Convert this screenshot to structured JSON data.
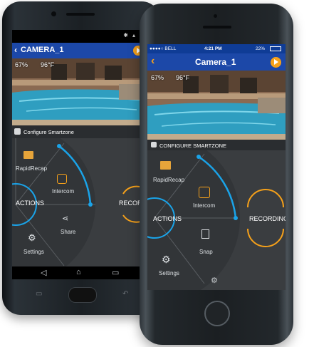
{
  "android": {
    "title": "CAMERA_1",
    "back_glyph": "‹",
    "humidity": "67%",
    "temperature": "96°F",
    "configure_label": "Configure Smartzone",
    "menu": {
      "rapidrecap": "RapidRecap",
      "intercom": "Intercom",
      "actions": "ACTIONS",
      "share": "Share",
      "settings": "Settings",
      "recording": "RECOR"
    },
    "nav": {
      "back": "◁",
      "home": "⌂",
      "recents": "▭"
    }
  },
  "iphone": {
    "carrier": "●●●●○ BELL",
    "time": "4:21 PM",
    "battery": "22%",
    "title": "Camera_1",
    "back_glyph": "‹",
    "humidity": "67%",
    "temperature": "96°F",
    "configure_label": "CONFIGURE SMARTZONE",
    "menu": {
      "rapidrecap": "RapidRecap",
      "intercom": "Intercom",
      "actions": "ACTIONS",
      "snap": "Snap",
      "settings": "Settings",
      "recording": "RECORDING"
    }
  },
  "colors": {
    "appbar": "#1c48a8",
    "accent_blue": "#1aa3e8",
    "accent_orange": "#f6a11a"
  }
}
